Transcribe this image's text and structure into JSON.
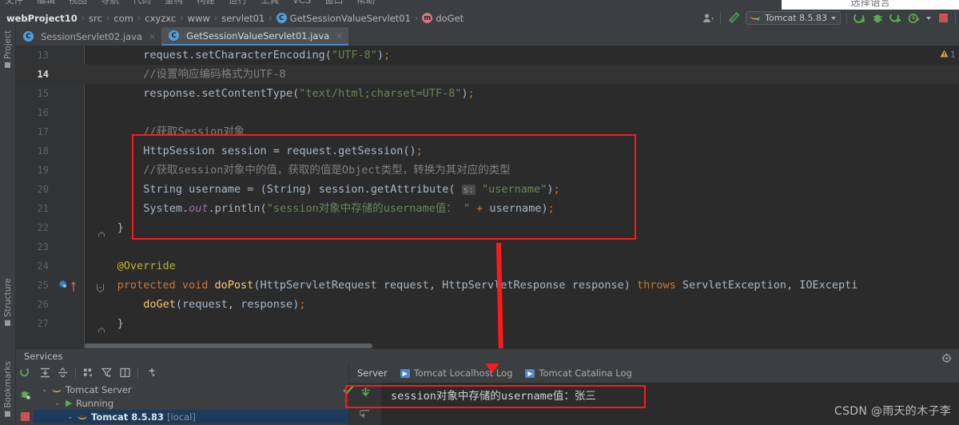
{
  "window": {
    "menu_items": [
      "文件",
      "编辑",
      "视图",
      "导航",
      "代码",
      "重构",
      "构建",
      "运行",
      "工具",
      "VCS",
      "窗口",
      "帮助"
    ]
  },
  "overlay": {
    "lang_popup_label": "选择语言"
  },
  "breadcrumb": {
    "items": [
      {
        "label": "webProject10",
        "bold": true,
        "icon": null
      },
      {
        "label": "src",
        "bold": false,
        "icon": null
      },
      {
        "label": "com",
        "bold": false,
        "icon": null
      },
      {
        "label": "cxyzxc",
        "bold": false,
        "icon": null
      },
      {
        "label": "www",
        "bold": false,
        "icon": null
      },
      {
        "label": "servlet01",
        "bold": false,
        "icon": null
      },
      {
        "label": "GetSessionValueServlet01",
        "bold": false,
        "icon": "class-icon",
        "icon_letter": "C"
      },
      {
        "label": "doGet",
        "bold": false,
        "icon": "method-icon",
        "icon_letter": "m"
      }
    ],
    "separator": "›"
  },
  "toolbar": {
    "profile_icon": "user-icon",
    "build_icon": "hammer-icon",
    "run_config": {
      "label": "Tomcat 8.5.83",
      "icon": "tomcat-icon"
    },
    "run_icon": "run-icon",
    "debug_icon": "debug-icon",
    "run_coverage_icon": "run-coverage-icon",
    "profiler_icon": "profiler-icon",
    "stop_icon": "stop-icon"
  },
  "tool_stripes": {
    "left": [
      {
        "label": "Project",
        "icon": "folder-icon"
      },
      {
        "label": "Structure",
        "icon": "structure-icon"
      },
      {
        "label": "Bookmarks",
        "icon": "bookmark-icon"
      }
    ]
  },
  "editor_tabs": [
    {
      "label": "SessionServlet02.java",
      "icon_letter": "C",
      "active": false,
      "close": "×"
    },
    {
      "label": "GetSessionValueServlet01.java",
      "icon_letter": "C",
      "active": true,
      "close": "×"
    }
  ],
  "editor": {
    "warning_icon": "warning-triangle-icon",
    "warning_count": "1",
    "current_line": "14",
    "lines": [
      {
        "num": "13",
        "indent": 8,
        "text": "request.setCharacterEncoding(\"UTF-8\");"
      },
      {
        "num": "14",
        "indent": 8,
        "text": "//设置响应编码格式为UTF-8",
        "current": true
      },
      {
        "num": "15",
        "indent": 8,
        "text": "response.setContentType(\"text/html;charset=UTF-8\");"
      },
      {
        "num": "16",
        "indent": 0,
        "text": ""
      },
      {
        "num": "17",
        "indent": 8,
        "text": "//获取Session对象"
      },
      {
        "num": "18",
        "indent": 8,
        "text": "HttpSession session = request.getSession();"
      },
      {
        "num": "19",
        "indent": 8,
        "text": "//获取session对象中的值，获取的值是Object类型，转换为其对应的类型"
      },
      {
        "num": "20",
        "indent": 8,
        "text": "String username = (String) session.getAttribute( s: \"username\");"
      },
      {
        "num": "21",
        "indent": 8,
        "text": "System.out.println(\"session对象中存储的username值： \" + username);"
      },
      {
        "num": "22",
        "indent": 4,
        "text": "}"
      },
      {
        "num": "23",
        "indent": 0,
        "text": ""
      },
      {
        "num": "24",
        "indent": 4,
        "text": "@Override"
      },
      {
        "num": "25",
        "indent": 4,
        "text": "protected void doPost(HttpServletRequest request, HttpServletResponse response) throws ServletException, IOExcepti"
      },
      {
        "num": "26",
        "indent": 8,
        "text": "doGet(request, response);"
      },
      {
        "num": "27",
        "indent": 4,
        "text": "}"
      }
    ],
    "param_hint": "s:",
    "breakpoint_line": "25"
  },
  "services": {
    "title": "Services",
    "settings_icon": "gear-icon",
    "side_icons": [
      "rerun-icon",
      "debug-icon",
      "stop-icon"
    ],
    "toolbar_icons": [
      "expand-all-icon",
      "collapse-all-icon",
      "group-icon",
      "filter-icon",
      "layout-icon",
      "add-icon"
    ],
    "tree": [
      {
        "label": "Tomcat Server",
        "icon": "tomcat-icon",
        "depth": 0,
        "chevron": "⌄",
        "selected": false
      },
      {
        "label": "Running",
        "icon": "run-icon",
        "depth": 1,
        "chevron": "⌄",
        "selected": false
      },
      {
        "label": "Tomcat 8.5.83",
        "suffix": " [local]",
        "icon": "tomcat-icon",
        "depth": 2,
        "chevron": "⌄",
        "selected": true,
        "bold": true
      }
    ],
    "status_check_icon": "check-icon",
    "log_tabs": [
      {
        "label": "Server",
        "icon": null,
        "active": true
      },
      {
        "label": "Tomcat Localhost Log",
        "icon": "console-icon",
        "active": false
      },
      {
        "label": "Tomcat Catalina Log",
        "icon": "console-icon",
        "active": false
      }
    ],
    "console_gutter_icons": [
      "scroll-to-end-icon",
      "soft-wrap-icon"
    ],
    "console_output": "session对象中存储的username值：张三"
  },
  "annotations": {
    "code_highlight_box_color": "#ff1a1a",
    "console_highlight_box_color": "#ff1a1a",
    "arrow_color": "#ff1a1a",
    "catalina_marker_color": "#ff1a1a"
  },
  "watermark": {
    "text": "CSDN @雨天的木子李"
  }
}
